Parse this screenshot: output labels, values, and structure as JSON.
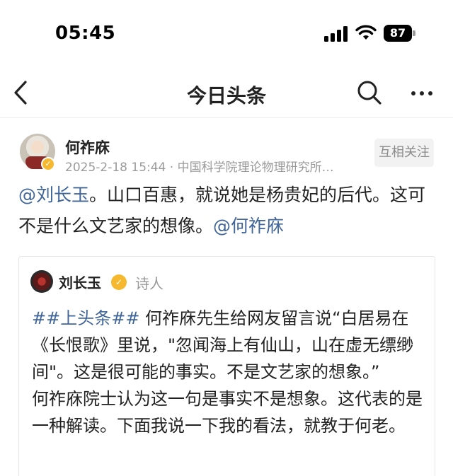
{
  "status_bar": {
    "time": "05:45",
    "battery": "87"
  },
  "nav": {
    "title": "今日头条",
    "icons": [
      "back-chevron-icon",
      "search-icon",
      "more-icon"
    ]
  },
  "post": {
    "author": "何祚庥",
    "meta": "2025-2-18 15:44 · 中国科学院理论物理研究所…",
    "follow_label": "互相关注",
    "mention_1": "@刘长玉",
    "body_1": "。山口百惠，就说她是杨贵妃的后代。这可不是什么文艺家的想像。",
    "mention_2": "@何祚庥"
  },
  "quote": {
    "author": "刘长玉",
    "role": "诗人",
    "hashtag": "##上头条##",
    "para_1_rest": " 何祚庥先生给网友留言说“白居易在《长恨歌》里说，\"忽闻海上有仙山，山在虚无缥缈间\"。这是很可能的事实。不是文艺家的想象。”",
    "para_2": "何祚庥院士认为这一句是事实不是想象。这代表的是一种解读。下面我说一下我的看法，就教于何老。"
  },
  "colors": {
    "link": "#406599",
    "badge": "#f5b82e",
    "meta_gray": "#9a9a9a"
  }
}
